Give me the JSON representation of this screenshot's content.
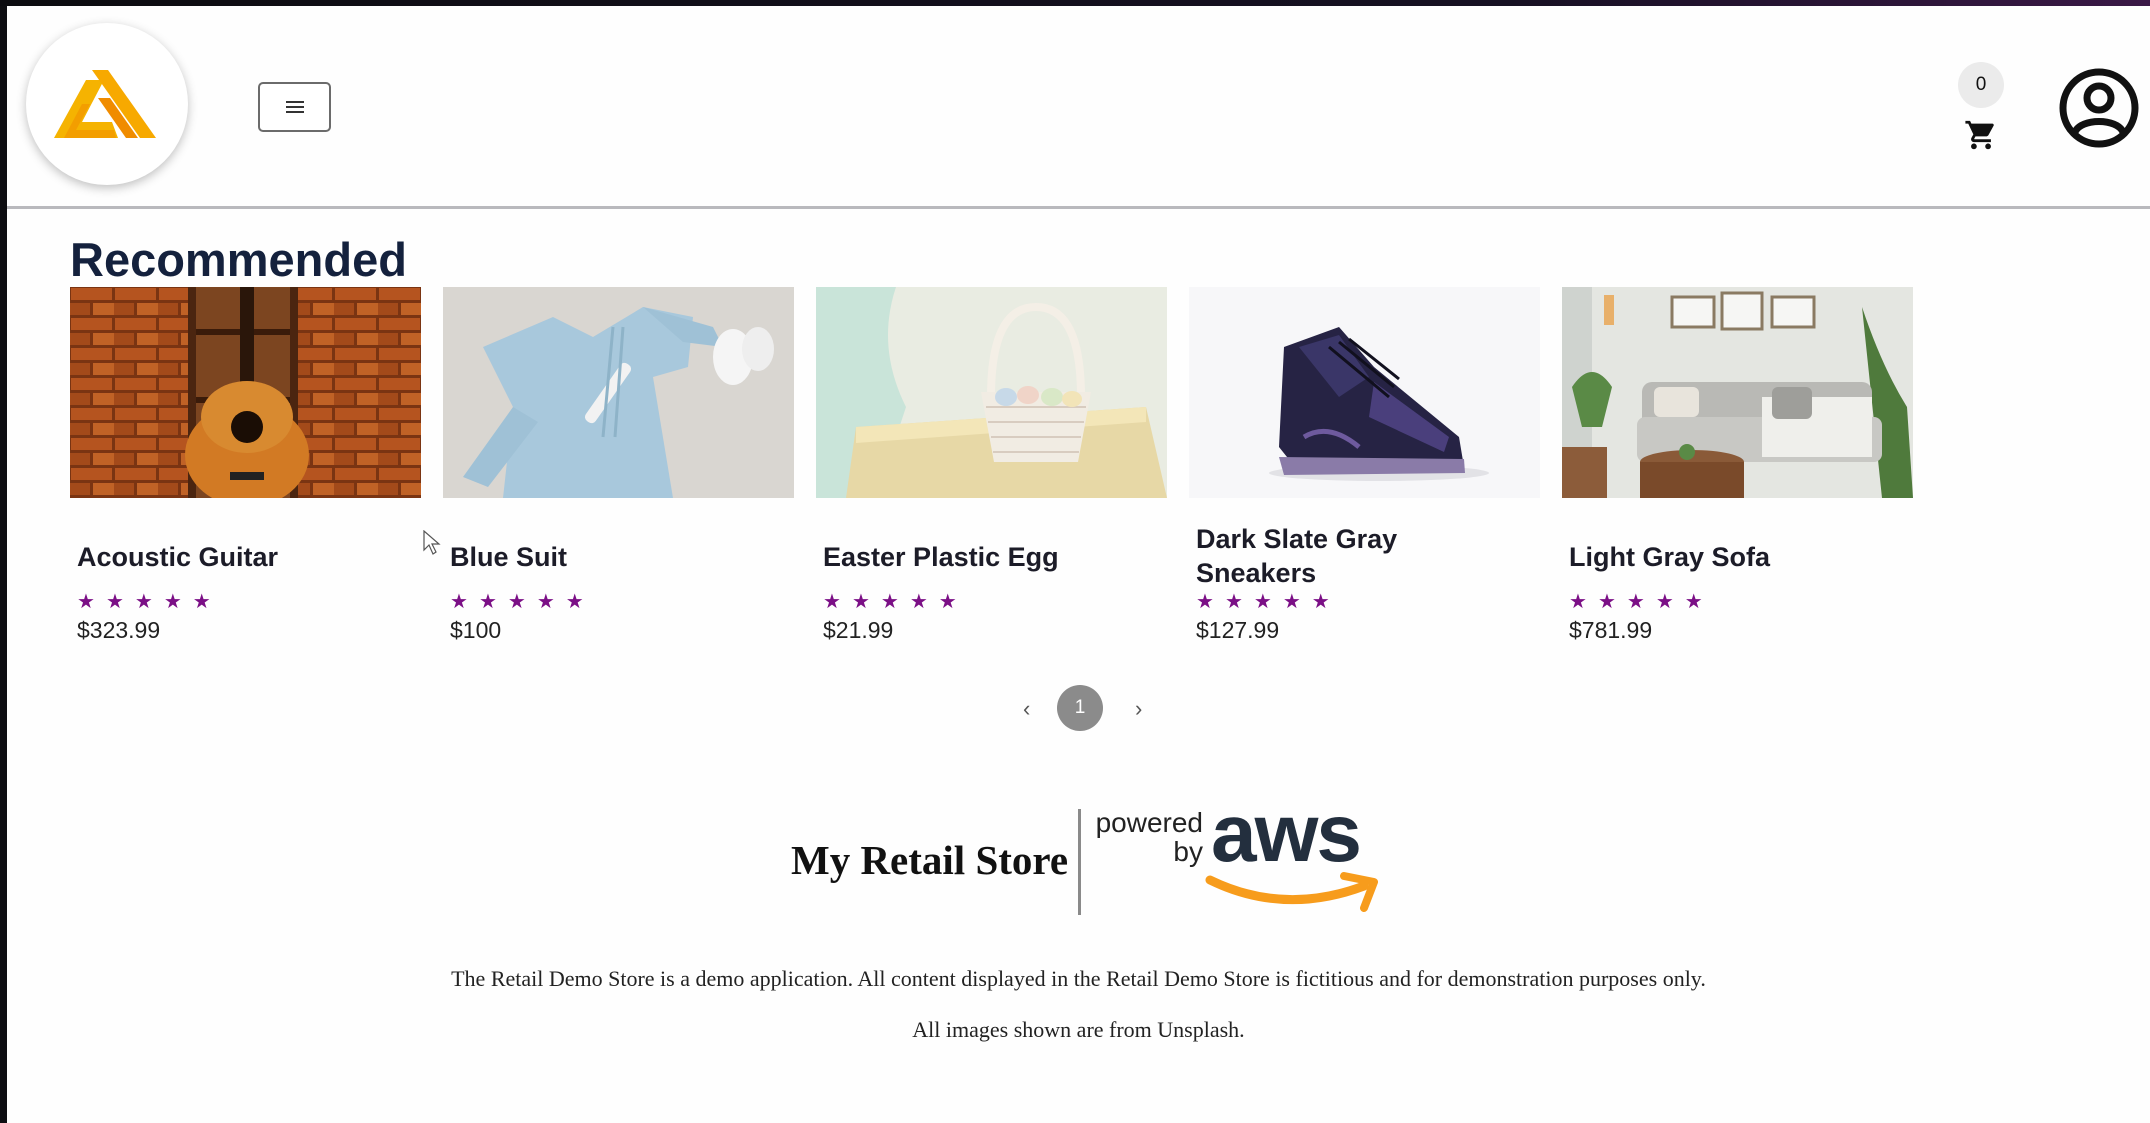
{
  "header": {
    "cart_count": "0",
    "logo_colors": [
      "#f5b301",
      "#f08c00"
    ]
  },
  "recommended": {
    "title": "Recommended",
    "products": [
      {
        "name": "Acoustic Guitar",
        "rating": 5,
        "price": "$323.99"
      },
      {
        "name": "Blue Suit",
        "rating": 5,
        "price": "$100"
      },
      {
        "name": "Easter Plastic Egg",
        "rating": 5,
        "price": "$21.99"
      },
      {
        "name": "Dark Slate Gray Sneakers",
        "rating": 5,
        "price": "$127.99"
      },
      {
        "name": "Light Gray Sofa",
        "rating": 5,
        "price": "$781.99"
      }
    ],
    "star_color": "#7b0f86"
  },
  "pagination": {
    "current_page": "1",
    "prev_icon": "chevron-left-icon",
    "next_icon": "chevron-right-icon"
  },
  "footer": {
    "store_name": "My Retail Store",
    "powered_line1": "powered",
    "powered_line2": "by",
    "aws_text": "aws",
    "disclaimer_1": "The Retail Demo Store is a demo application. All content displayed in the Retail Demo Store is fictitious and for demonstration purposes only.",
    "disclaimer_2": "All images shown are from Unsplash."
  }
}
